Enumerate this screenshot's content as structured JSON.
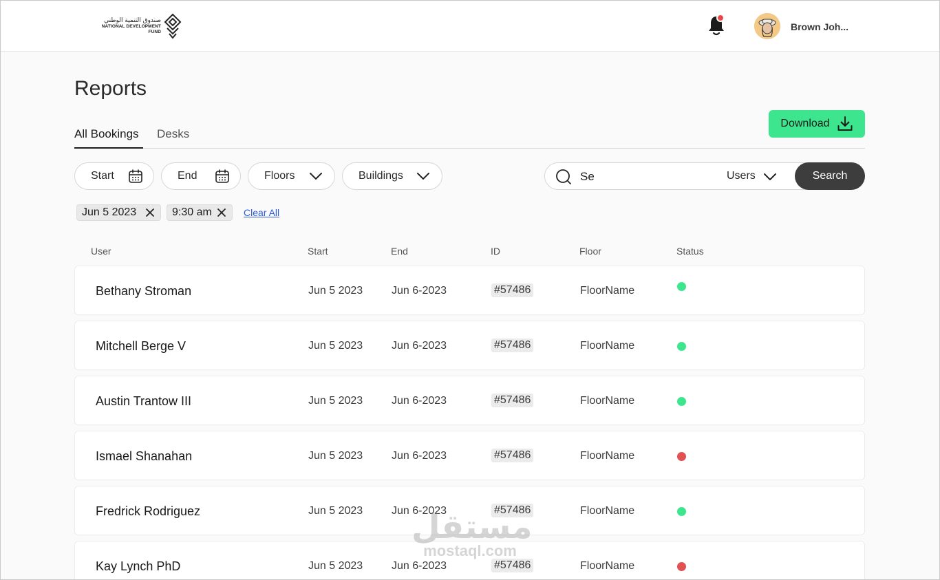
{
  "header": {
    "logo_ar": "صندوق التنمية الوطني",
    "logo_en_line1": "NATIONAL DEVELOPMENT",
    "logo_en_line2": "FUND",
    "user_name": "Brown Joh..."
  },
  "page": {
    "title": "Reports"
  },
  "tabs": [
    {
      "label": "All Bookings",
      "active": true
    },
    {
      "label": "Desks",
      "active": false
    }
  ],
  "download_label": "Download",
  "filters": {
    "start_label": "Start",
    "end_label": "End",
    "floors_label": "Floors",
    "buildings_label": "Buildings"
  },
  "search": {
    "value": "Se",
    "scope": "Users",
    "button_label": "Search"
  },
  "chips": [
    "Jun 5 2023",
    "9:30 am"
  ],
  "clear_all_label": "Clear All",
  "table": {
    "columns": [
      "User",
      "Start",
      "End",
      "ID",
      "Floor",
      "Status"
    ],
    "rows": [
      {
        "user": "Bethany Stroman",
        "start": "Jun 5 2023",
        "end": "Jun 6-2023",
        "id": "#57486",
        "floor": "FloorName",
        "status": "green"
      },
      {
        "user": "Mitchell Berge V",
        "start": "Jun 5 2023",
        "end": "Jun 6-2023",
        "id": "#57486",
        "floor": "FloorName",
        "status": "green"
      },
      {
        "user": "Austin Trantow III",
        "start": "Jun 5 2023",
        "end": "Jun 6-2023",
        "id": "#57486",
        "floor": "FloorName",
        "status": "green"
      },
      {
        "user": "Ismael Shanahan",
        "start": "Jun 5 2023",
        "end": "Jun 6-2023",
        "id": "#57486",
        "floor": "FloorName",
        "status": "red"
      },
      {
        "user": "Fredrick Rodriguez",
        "start": "Jun 5 2023",
        "end": "Jun 6-2023",
        "id": "#57486",
        "floor": "FloorName",
        "status": "green"
      },
      {
        "user": "Kay Lynch PhD",
        "start": "Jun 5 2023",
        "end": "Jun 6-2023",
        "id": "#57486",
        "floor": "FloorName",
        "status": "red"
      }
    ]
  },
  "colors": {
    "accent_green": "#3ee58f",
    "status_green": "#3ee58f",
    "status_red": "#e05252",
    "link_blue": "#2f5bd8"
  },
  "watermark": {
    "ar": "مستقل",
    "en": "mostaql.com"
  }
}
